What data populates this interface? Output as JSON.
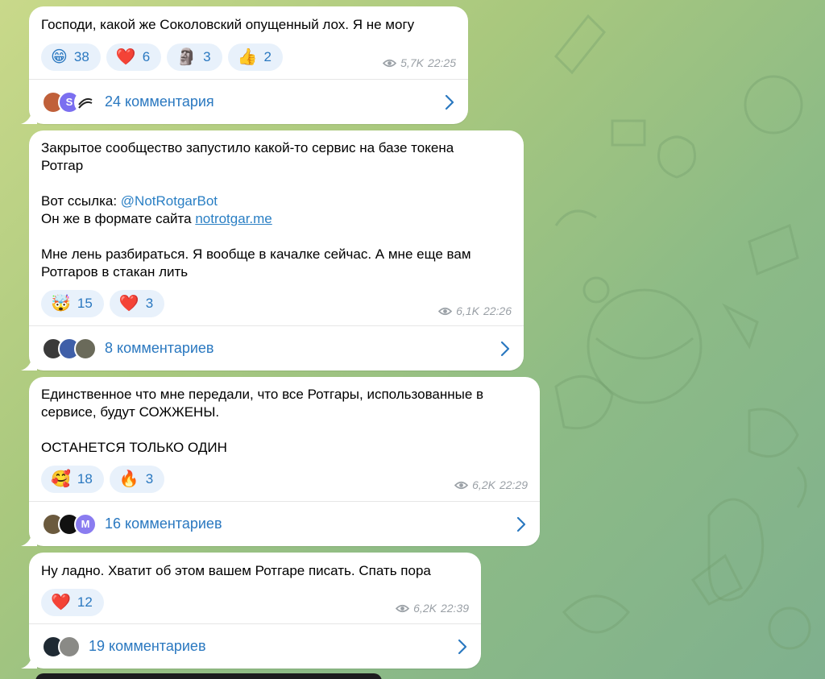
{
  "messages": [
    {
      "text": "Господи, какой же Соколовский опущенный лох. Я не могу",
      "reactions": [
        {
          "emoji": "😁",
          "count": "38"
        },
        {
          "emoji": "❤️",
          "count": "6"
        },
        {
          "emoji": "🗿",
          "count": "3"
        },
        {
          "emoji": "👍",
          "count": "2"
        }
      ],
      "views": "5,7K",
      "time": "22:25",
      "comments_label": "24 комментария",
      "avatar_letters": [
        "",
        "S",
        ""
      ]
    },
    {
      "text_line1": "Закрытое сообщество запустило какой-то сервис на базе токена",
      "text_line2": "Ротгар",
      "link_prefix": "Вот ссылка: ",
      "bot_link": "@NotRotgarBot",
      "site_prefix": "Он же в формате сайта ",
      "site_link": "notrotgar.me",
      "text_line5": "Мне лень разбираться. Я вообще в качалке сейчас. А мне еще вам",
      "text_line6": "Ротгаров в стакан лить",
      "reactions": [
        {
          "emoji": "🤯",
          "count": "15"
        },
        {
          "emoji": "❤️",
          "count": "3"
        }
      ],
      "views": "6,1K",
      "time": "22:26",
      "comments_label": "8 комментариев"
    },
    {
      "text_line1": "Единственное что мне передали, что все Ротгары, использованные в",
      "text_line2": "сервисе, будут СОЖЖЕНЫ.",
      "text_line3": "ОСТАНЕТСЯ ТОЛЬКО ОДИН",
      "reactions": [
        {
          "emoji": "🥰",
          "count": "18"
        },
        {
          "emoji": "🔥",
          "count": "3"
        }
      ],
      "views": "6,2K",
      "time": "22:29",
      "comments_label": "16 комментариев",
      "avatar_letters": [
        "",
        "",
        "M"
      ]
    },
    {
      "text": "Ну ладно. Хватит об этом вашем Ротгаре писать. Спать пора",
      "reactions": [
        {
          "emoji": "❤️",
          "count": "12"
        }
      ],
      "views": "6,2K",
      "time": "22:39",
      "comments_label": "19 комментариев"
    }
  ],
  "colors": {
    "accent": "#2a78c0",
    "reaction_bg": "#e8f1fb",
    "meta": "#9aa0a6"
  }
}
